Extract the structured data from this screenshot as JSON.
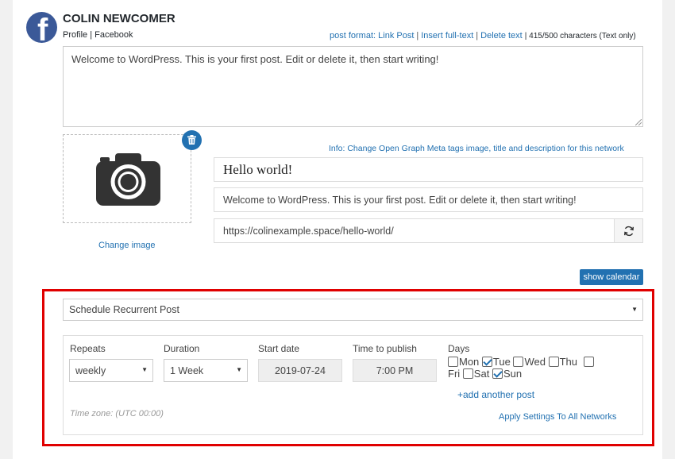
{
  "account": {
    "name": "COLIN NEWCOMER",
    "sub": "Profile | Facebook",
    "brand_color": "#3b5998"
  },
  "toolbar": {
    "post_format": "post format: Link Post",
    "insert_full_text": "Insert full-text",
    "delete_text": "Delete text",
    "separator": "|",
    "char_count": "| 415/500 characters (Text only)"
  },
  "message": {
    "text": "Welcome to WordPress. This is your first post. Edit or delete it, then start writing!"
  },
  "image": {
    "icon": "camera-icon",
    "delete_icon": "trash-icon",
    "change_label": "Change image"
  },
  "open_graph": {
    "info": "Info: Change Open Graph Meta tags image, title and description for this network",
    "title": "Hello world!",
    "description": "Welcome to WordPress. This is your first post. Edit or delete it, then start writing!",
    "url": "https://colinexample.space/hello-world/",
    "refresh_icon": "refresh-icon"
  },
  "calendar": {
    "show_label": "show calendar"
  },
  "schedule": {
    "type": "Schedule Recurrent Post",
    "repeats_label": "Repeats",
    "repeats_value": "weekly",
    "duration_label": "Duration",
    "duration_value": "1 Week",
    "start_date_label": "Start date",
    "start_date_value": "2019-07-24",
    "time_label": "Time to publish",
    "time_value": "7:00 PM",
    "days_label": "Days",
    "days": [
      {
        "label": "Mon",
        "checked": false
      },
      {
        "label": "Tue",
        "checked": true
      },
      {
        "label": "Wed",
        "checked": false
      },
      {
        "label": "Thu",
        "checked": false
      },
      {
        "label": "Fri",
        "checked": false
      },
      {
        "label": "Sat",
        "checked": false
      },
      {
        "label": "Sun",
        "checked": true
      }
    ],
    "add_another": "+add another post",
    "timezone": "Time zone: (UTC 00:00)",
    "apply_all": "Apply Settings To All Networks"
  },
  "colors": {
    "accent": "#2271b1",
    "highlight_border": "#e00000"
  }
}
